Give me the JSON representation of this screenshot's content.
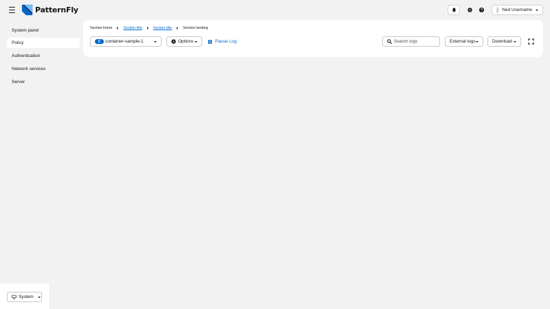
{
  "brand": {
    "name": "PatternFly"
  },
  "masthead": {
    "menu_icon": "hamburger-icon",
    "notifications_icon": "bell-icon",
    "settings_icon": "gear-icon",
    "help_icon": "question-circle-icon",
    "user": {
      "name": "Ned Username",
      "avatar_icon": "avatar-icon"
    }
  },
  "sidebar": {
    "items": [
      {
        "label": "System panel",
        "active": false
      },
      {
        "label": "Policy",
        "active": true
      },
      {
        "label": "Authentication",
        "active": false
      },
      {
        "label": "Network services",
        "active": false
      },
      {
        "label": "Server",
        "active": false
      }
    ],
    "footer": {
      "theme_label": "System",
      "theme_icon": "monitor-icon"
    }
  },
  "breadcrumb": [
    {
      "label": "Section home",
      "link": false
    },
    {
      "label": "Section title",
      "link": true
    },
    {
      "label": "Section title",
      "link": true
    },
    {
      "label": "Section landing",
      "link": false
    }
  ],
  "toolbar": {
    "container": {
      "badge": "C",
      "value": "container-sample-1"
    },
    "options_label": "Options",
    "pause_label": "Pause Log",
    "search": {
      "placeholder": "Search logs",
      "value": ""
    },
    "external_logs_label": "External logs",
    "download_label": "Download",
    "fullscreen_icon": "expand-icon"
  },
  "colors": {
    "background": "#f2f2f2",
    "card": "#ffffff",
    "link": "#0066cc",
    "badge": "#0066cc",
    "text": "#151515",
    "border": "#c7c7c7"
  }
}
